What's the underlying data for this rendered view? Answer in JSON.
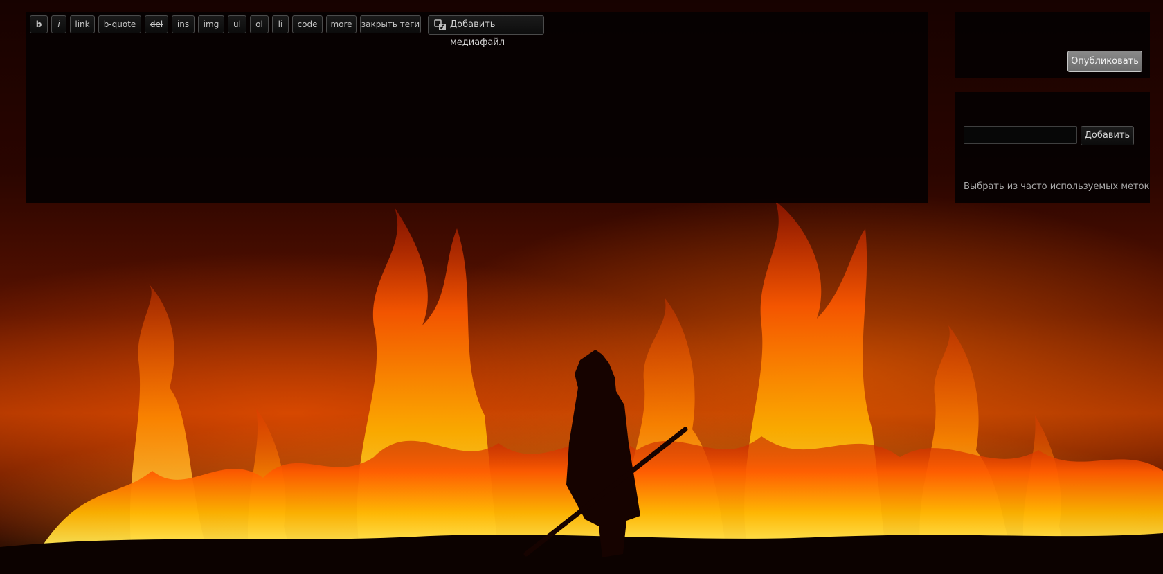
{
  "editor": {
    "quicktags": [
      {
        "id": "b",
        "label": "b"
      },
      {
        "id": "i",
        "label": "i"
      },
      {
        "id": "link",
        "label": "link"
      },
      {
        "id": "bquote",
        "label": "b-quote"
      },
      {
        "id": "del",
        "label": "del"
      },
      {
        "id": "ins",
        "label": "ins"
      },
      {
        "id": "img",
        "label": "img"
      },
      {
        "id": "ul",
        "label": "ul"
      },
      {
        "id": "ol",
        "label": "ol"
      },
      {
        "id": "li",
        "label": "li"
      },
      {
        "id": "code",
        "label": "code"
      },
      {
        "id": "more",
        "label": "more"
      },
      {
        "id": "close",
        "label": "закрыть теги"
      }
    ],
    "media_button": {
      "label": "Добавить медиафайл",
      "icon": "media-icon"
    },
    "content": ""
  },
  "publish": {
    "button_label": "Опубликовать"
  },
  "tags": {
    "input_value": "",
    "add_label": "Добавить",
    "popular_link": "Выбрать из часто используемых меток"
  },
  "colors": {
    "panel_bg": "#050101",
    "button_text": "#c4c4c4",
    "publish_bg": "#7a7a7a",
    "fire_orange": "#ff6a00",
    "fire_yellow": "#ffd23a"
  },
  "background": {
    "icon": "wildfire-image"
  }
}
